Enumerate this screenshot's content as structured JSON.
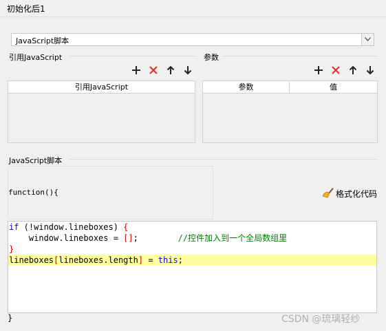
{
  "window": {
    "title": "初始化后1"
  },
  "script_type": {
    "selected": "JavaScript脚本"
  },
  "ref_group": {
    "label": "引用JavaScript",
    "columns": [
      "引用JavaScript"
    ]
  },
  "param_group": {
    "label": "参数",
    "columns": [
      "参数",
      "值"
    ]
  },
  "toolbar_icons": [
    "plus-icon",
    "delete-x-icon",
    "arrow-up-icon",
    "arrow-down-icon"
  ],
  "script_group": {
    "label": "JavaScript脚本",
    "function_header": "function(){",
    "format_button": "格式化代码",
    "closing": "}"
  },
  "code": {
    "line1": {
      "kw": "if",
      "a": " (!window.lineboxes) ",
      "b": "{"
    },
    "line2": {
      "a": "    window.lineboxes = ",
      "b": "[]",
      "c": ";        ",
      "comment": "//控件加入到一个全局数组里"
    },
    "line3": {
      "b": "}"
    },
    "line4": {
      "a": "lineboxes",
      "b1": "[",
      "c": "lineboxes.length",
      "b2": "]",
      "d": " = ",
      "kw": "this",
      "e": ";"
    }
  },
  "watermark": "CSDN @琉璃轻纱",
  "colors": {
    "delete_red": "#e03030",
    "highlight_line": "#ffff9f",
    "keyword_blue": "#0000ff",
    "comment_green": "#008000"
  }
}
